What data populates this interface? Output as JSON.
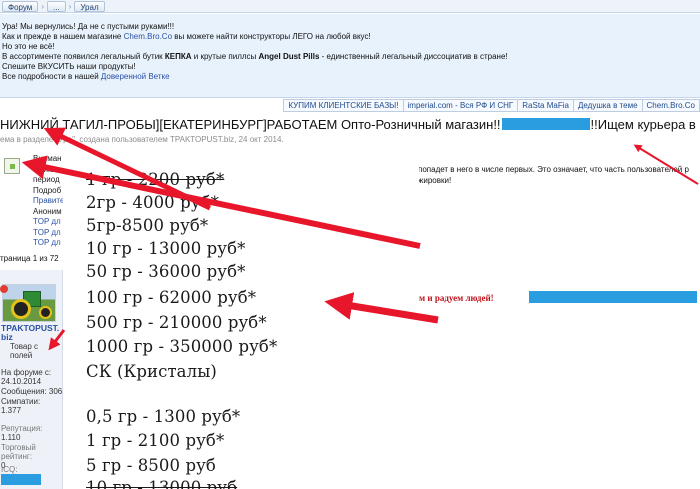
{
  "breadcrumb": [
    "Форум",
    "...",
    "Урал"
  ],
  "notice": {
    "line1": "Ура! Мы вернулись! Да не с пустыми руками!!!",
    "line2_pre": "Как и прежде в нашем магазине ",
    "line2_link": "Chem.Bro.Co",
    "line2_post": " вы можете найти конструкторы ЛЕГО на любой вкус!",
    "line3": "Но это не всё!",
    "line4_pre": "В ассортименте появился легальный бутик ",
    "line4_b1": "КЕПКА",
    "line4_mid": " и крутые пиллсы ",
    "line4_b2": "Angel Dust Pills",
    "line4_post": " - единственный легальный диссоциатив в стране!",
    "line5": "Спешите ВКУСИТЬ наши продукты!",
    "line6_pre": "Все подробности в нашей ",
    "line6_link": "Доверенной Ветке"
  },
  "linkbar": [
    "КУПИМ КЛИЕНТСКИЕ БАЗЫ!",
    "imperial.com - Вся РФ И СНГ",
    "RaSta MaFia",
    "Дедушка в теме",
    "Chem.Bro.Co"
  ],
  "thread": {
    "title_left": "НИЖНИЙ ТАГИЛ-ПРОБЫ][ЕКАТЕРИНБУРГ]РАБОТАЕМ Опто-Розничный магазин!!",
    "title_right": "!!Ищем курьера в НТ",
    "sub_pre": "ема в разделе \"",
    "sub_link": "Ура",
    "sub_post": "\", создана пользователем TPAKTOPUST.biz, 24 окт 2014."
  },
  "post1": {
    "meta": [
      "Вниман",
      "11 июл",
      "период",
      "Подроб",
      "Правите",
      "Аноним",
      "TOP дл",
      "TOP дл",
      "TOP дл"
    ],
    "right1": "попадет в него в числе первых. Это означает, что часть пользователей р",
    "right2": "жировки!"
  },
  "pagination": "траница 1 из 72",
  "user": {
    "name1": "TPAKTOPUST.",
    "name2": "biz",
    "status1": "Товар с",
    "status2": "полей",
    "joined_label": "На форуме с:",
    "joined": "24.10.2014",
    "posts_label": "Сообщения: 306",
    "likes_label": "Симпатии:",
    "likes": "1.377",
    "rep_label": "Репутация:",
    "rep": "1.110",
    "trade_label": "Торговый",
    "trade_label2": "рейтинг:",
    "trade": "0",
    "ico_label": "ICQ:"
  },
  "post2": {
    "text": "таем и радуем людей!"
  },
  "prices": [
    "1 гр - 2200 руб*",
    "2гр - 4000 руб*",
    "5гр-8500 руб*",
    "10 гр - 13000 руб*",
    "50 гр - 36000 руб*",
    "100 гр - 62000 руб*",
    "500 гр - 210000 руб*",
    "1000 гр - 350000 руб*",
    "СК (Кристалы)",
    "0,5 гр - 1300 руб*",
    "1 гр - 2100 руб*",
    "5 гр - 8500 руб",
    "10 гр - 13000 руб"
  ],
  "colors": {
    "redact": "#2a9de0",
    "arrow": "#e8162a",
    "accent_link": "#2b51a6"
  }
}
